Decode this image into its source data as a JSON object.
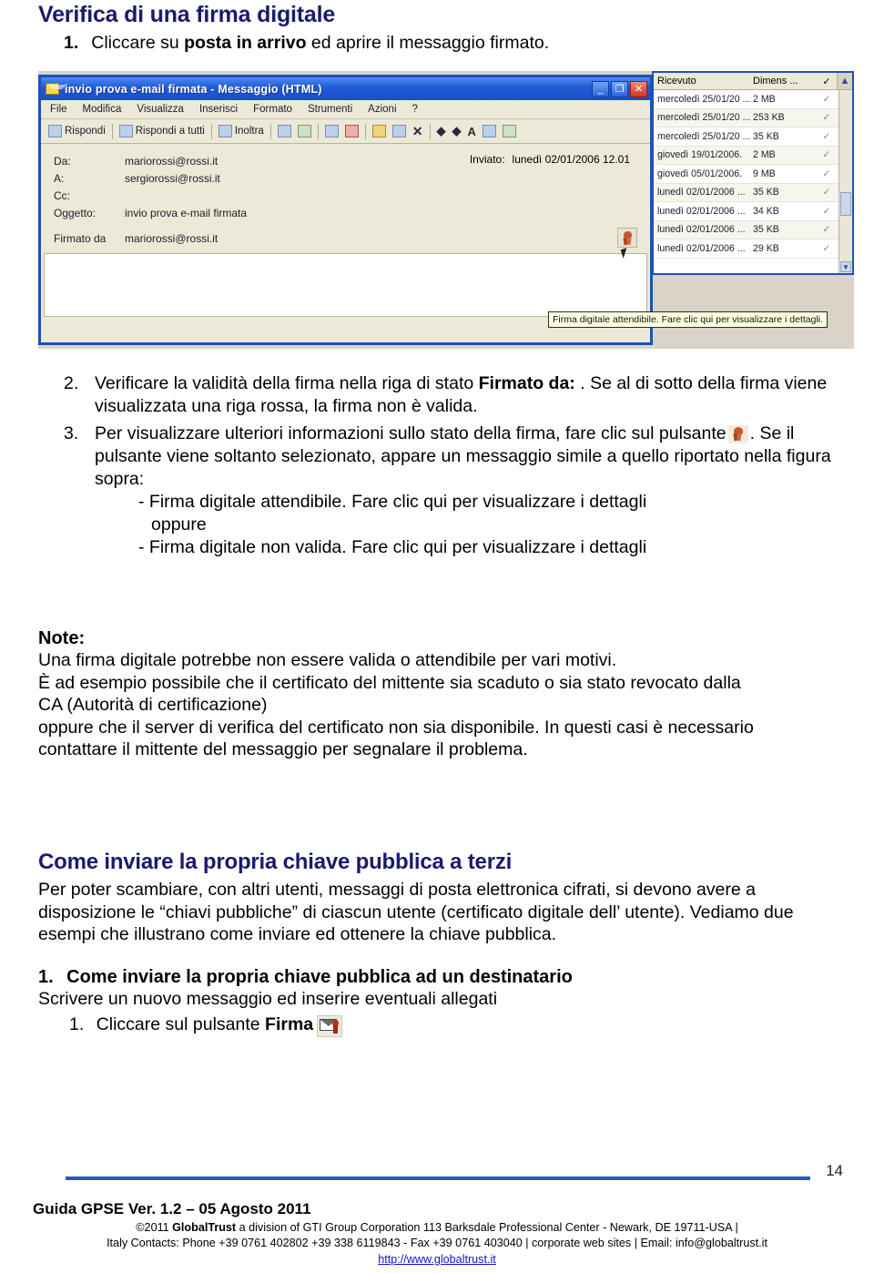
{
  "document": {
    "title": "Verifica di una firma digitale",
    "page_number": "14"
  },
  "steps_top": {
    "num": "1.",
    "text_before": "Cliccare su ",
    "bold": "posta in arrivo",
    "text_after": " ed aprire il messaggio firmato."
  },
  "screenshot": {
    "window": {
      "title": "invio prova e-mail firmata - Messaggio (HTML)",
      "minimize_label": "_",
      "maximize_label": "❐",
      "close_label": "✕",
      "menus": [
        "File",
        "Modifica",
        "Visualizza",
        "Inserisci",
        "Formato",
        "Strumenti",
        "Azioni",
        "?"
      ],
      "toolbar": [
        "Rispondi",
        "Rispondi a tutti",
        "Inoltra"
      ],
      "headers": [
        {
          "label": "Da:",
          "value": "mariorossi@rossi.it"
        },
        {
          "label": "A:",
          "value": "sergiorossi@rossi.it"
        },
        {
          "label": "Cc:",
          "value": ""
        },
        {
          "label": "Oggetto:",
          "value": "invio prova e-mail firmata"
        }
      ],
      "sent_label": "Inviato:",
      "sent_value": "lunedì 02/01/2006 12.01",
      "signed_label": "Firmato da",
      "signed_value": "mariorossi@rossi.it",
      "tooltip": "Firma digitale attendibile. Fare clic qui per visualizzare i dettagli."
    },
    "message_list": {
      "columns": [
        "Ricevuto",
        "Dimens ...",
        "✓"
      ],
      "rows": [
        {
          "received": "mercoledì 25/01/20 ...",
          "size": "2 MB",
          "flag": "✓"
        },
        {
          "received": "mercoledì 25/01/20 ...",
          "size": "253 KB",
          "flag": "✓"
        },
        {
          "received": "mercoledì 25/01/20 ...",
          "size": "35 KB",
          "flag": "✓"
        },
        {
          "received": "giovedì 19/01/2006.",
          "size": "2 MB",
          "flag": "✓"
        },
        {
          "received": "giovedì 05/01/2006.",
          "size": "9 MB",
          "flag": "✓"
        },
        {
          "received": "lunedì 02/01/2006 ...",
          "size": "35 KB",
          "flag": "✓"
        },
        {
          "received": "lunedì 02/01/2006 ...",
          "size": "34 KB",
          "flag": "✓"
        },
        {
          "received": "lunedì 02/01/2006 ...",
          "size": "35 KB",
          "flag": "✓"
        },
        {
          "received": "lunedì 02/01/2006 ...",
          "size": "29 KB",
          "flag": "✓"
        }
      ]
    }
  },
  "steps": [
    {
      "num": "2.",
      "part1": "Verificare la validità della firma nella riga di stato ",
      "bold": "Firmato da:",
      "part2": " . Se al di sotto della firma viene visualizzata una riga rossa, la firma non è valida."
    },
    {
      "num": "3.",
      "part1": "Per visualizzare ulteriori informazioni sullo stato della firma, fare clic sul pulsante",
      "part2": ". Se il pulsante viene soltanto selezionato, appare un messaggio simile a quello riportato nella figura sopra:",
      "sub_lines": [
        "- Firma digitale attendibile. Fare clic qui per visualizzare i dettagli",
        "oppure",
        "- Firma digitale non valida. Fare clic qui per visualizzare i dettagli"
      ]
    }
  ],
  "note": {
    "title": "Note:",
    "lines": [
      "Una firma digitale potrebbe non essere valida o attendibile per vari motivi.",
      "È ad esempio possibile che il certificato del mittente sia scaduto o  sia stato revocato dalla",
      "CA (Autorità di certificazione)",
      "oppure che il server di verifica del certificato non sia disponibile. In questi casi è necessario",
      "contattare il mittente del messaggio per segnalare il problema."
    ]
  },
  "section": {
    "heading": "Come inviare la propria chiave pubblica a terzi",
    "paragraph": "Per poter scambiare, con altri utenti, messaggi di posta elettronica cifrati, si devono avere a disposizione le “chiavi pubbliche” di ciascun utente (certificato digitale dell’ utente).  Vediamo due esempi che illustrano come inviare ed ottenere la chiave pubblica."
  },
  "bottom": {
    "num": "1.",
    "heading": "Come inviare la propria chiave pubblica ad un destinatario",
    "subtext": "Scrivere un nuovo messaggio ed inserire eventuali allegati",
    "inner_num": "1.",
    "inner_before": "Cliccare sul pulsante ",
    "inner_bold": "Firma"
  },
  "footer": {
    "title": "Guida GPSE Ver. 1.2 – 05 Agosto 2011",
    "line1_pre": "©2011 ",
    "line1_brand": "GlobalTrust",
    "line1_post": " a division of GTI Group Corporation 113 Barksdale Professional Center - Newark, DE 19711-USA |",
    "line2": "Italy Contacts: Phone +39 0761 402802  +39 338 6119843 - Fax +39 0761 403040 | corporate web sites |  Email: info@globaltrust.it",
    "url": "http://www.globaltrust.it"
  },
  "colors": {
    "heading_blue": "#1a1a6e",
    "rule_blue": "#1f5fbe",
    "link_blue": "#1111cc",
    "titlebar_blue": "#2158d4"
  }
}
